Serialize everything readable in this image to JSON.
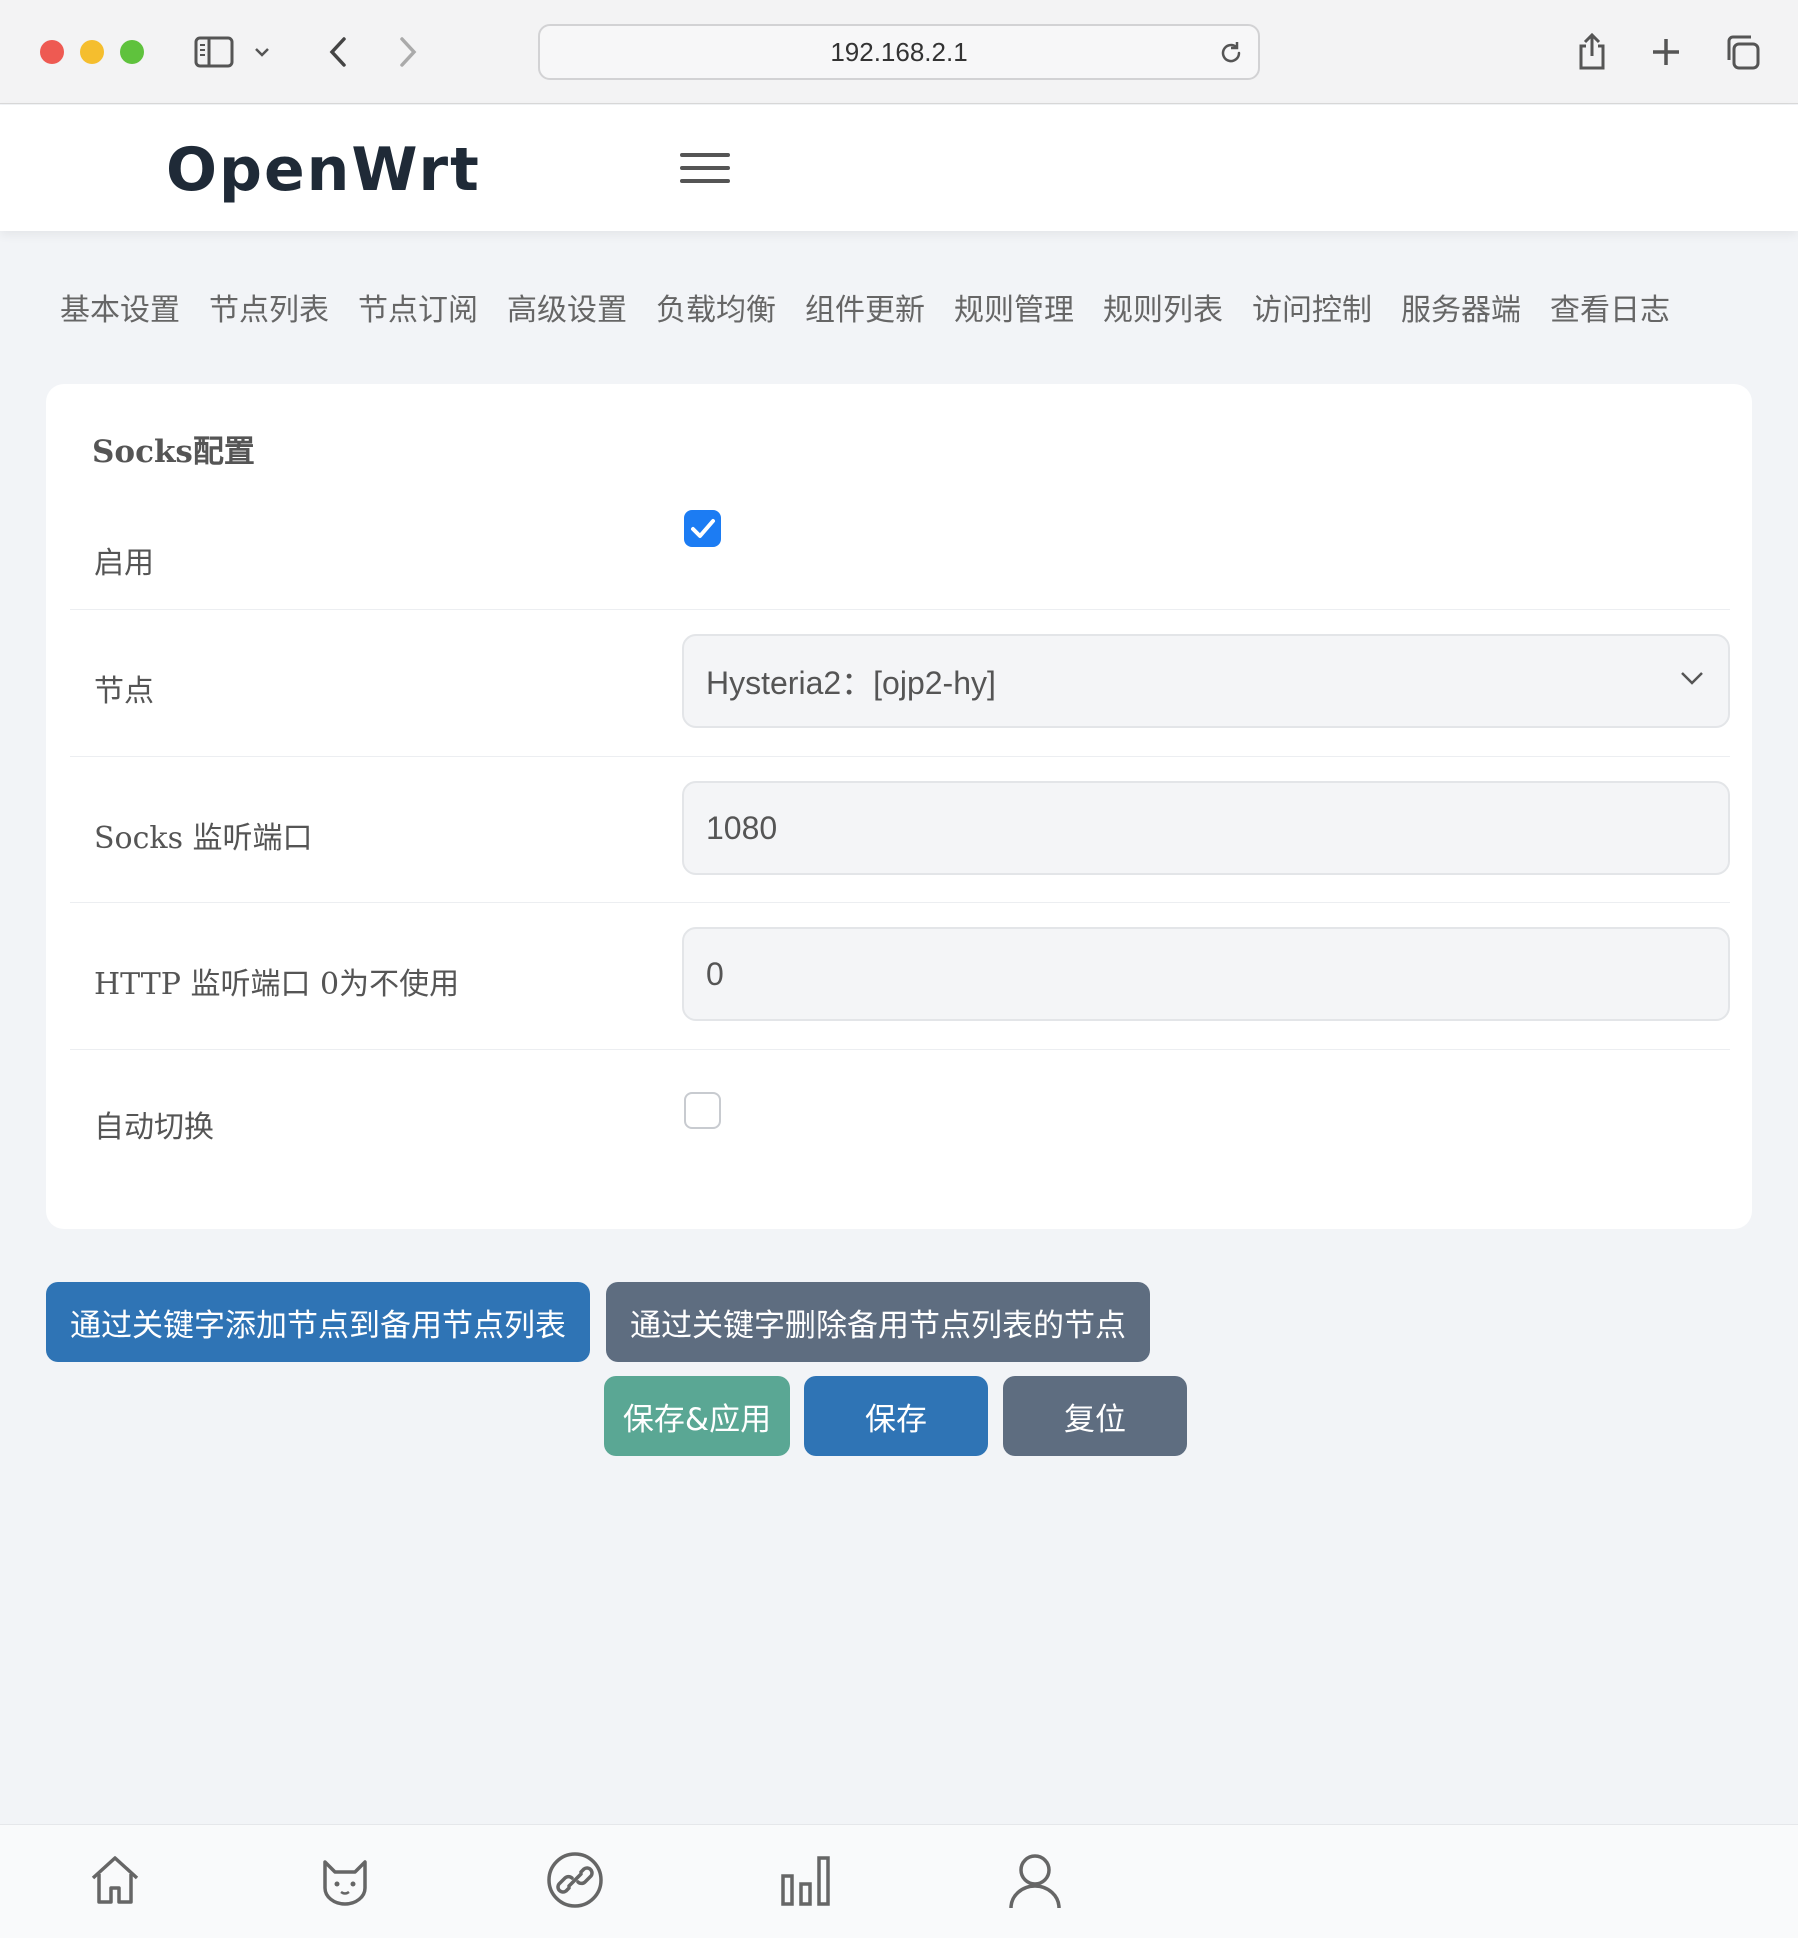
{
  "browser": {
    "url": "192.168.2.1"
  },
  "header": {
    "brand": "OpenWrt"
  },
  "tabs": [
    {
      "label": "基本设置"
    },
    {
      "label": "节点列表"
    },
    {
      "label": "节点订阅"
    },
    {
      "label": "高级设置"
    },
    {
      "label": "负载均衡"
    },
    {
      "label": "组件更新"
    },
    {
      "label": "规则管理"
    },
    {
      "label": "规则列表"
    },
    {
      "label": "访问控制"
    },
    {
      "label": "服务器端"
    },
    {
      "label": "查看日志"
    }
  ],
  "section": {
    "title": "Socks配置",
    "enable": {
      "label": "启用",
      "checked": true
    },
    "node": {
      "label": "节点",
      "value": "Hysteria2：[ojp2-hy]"
    },
    "socks_port": {
      "label": "Socks 监听端口",
      "value": "1080"
    },
    "http_port": {
      "label": "HTTP 监听端口 0为不使用",
      "value": "0"
    },
    "auto_switch": {
      "label": "自动切换",
      "checked": false
    }
  },
  "actions": {
    "add_by_keyword": "通过关键字添加节点到备用节点列表",
    "delete_by_keyword": "通过关键字删除备用节点列表的节点",
    "save_apply": "保存&应用",
    "save": "保存",
    "reset": "复位"
  },
  "bottom_nav": [
    {
      "icon": "home-icon"
    },
    {
      "icon": "cat-icon"
    },
    {
      "icon": "link-icon"
    },
    {
      "icon": "bar-chart-icon"
    },
    {
      "icon": "user-icon"
    }
  ],
  "colors": {
    "accent_blue": "#2f74b5",
    "gray_button": "#5e6d80",
    "green_button": "#5aa794",
    "checkbox_blue": "#1c7cf3"
  }
}
